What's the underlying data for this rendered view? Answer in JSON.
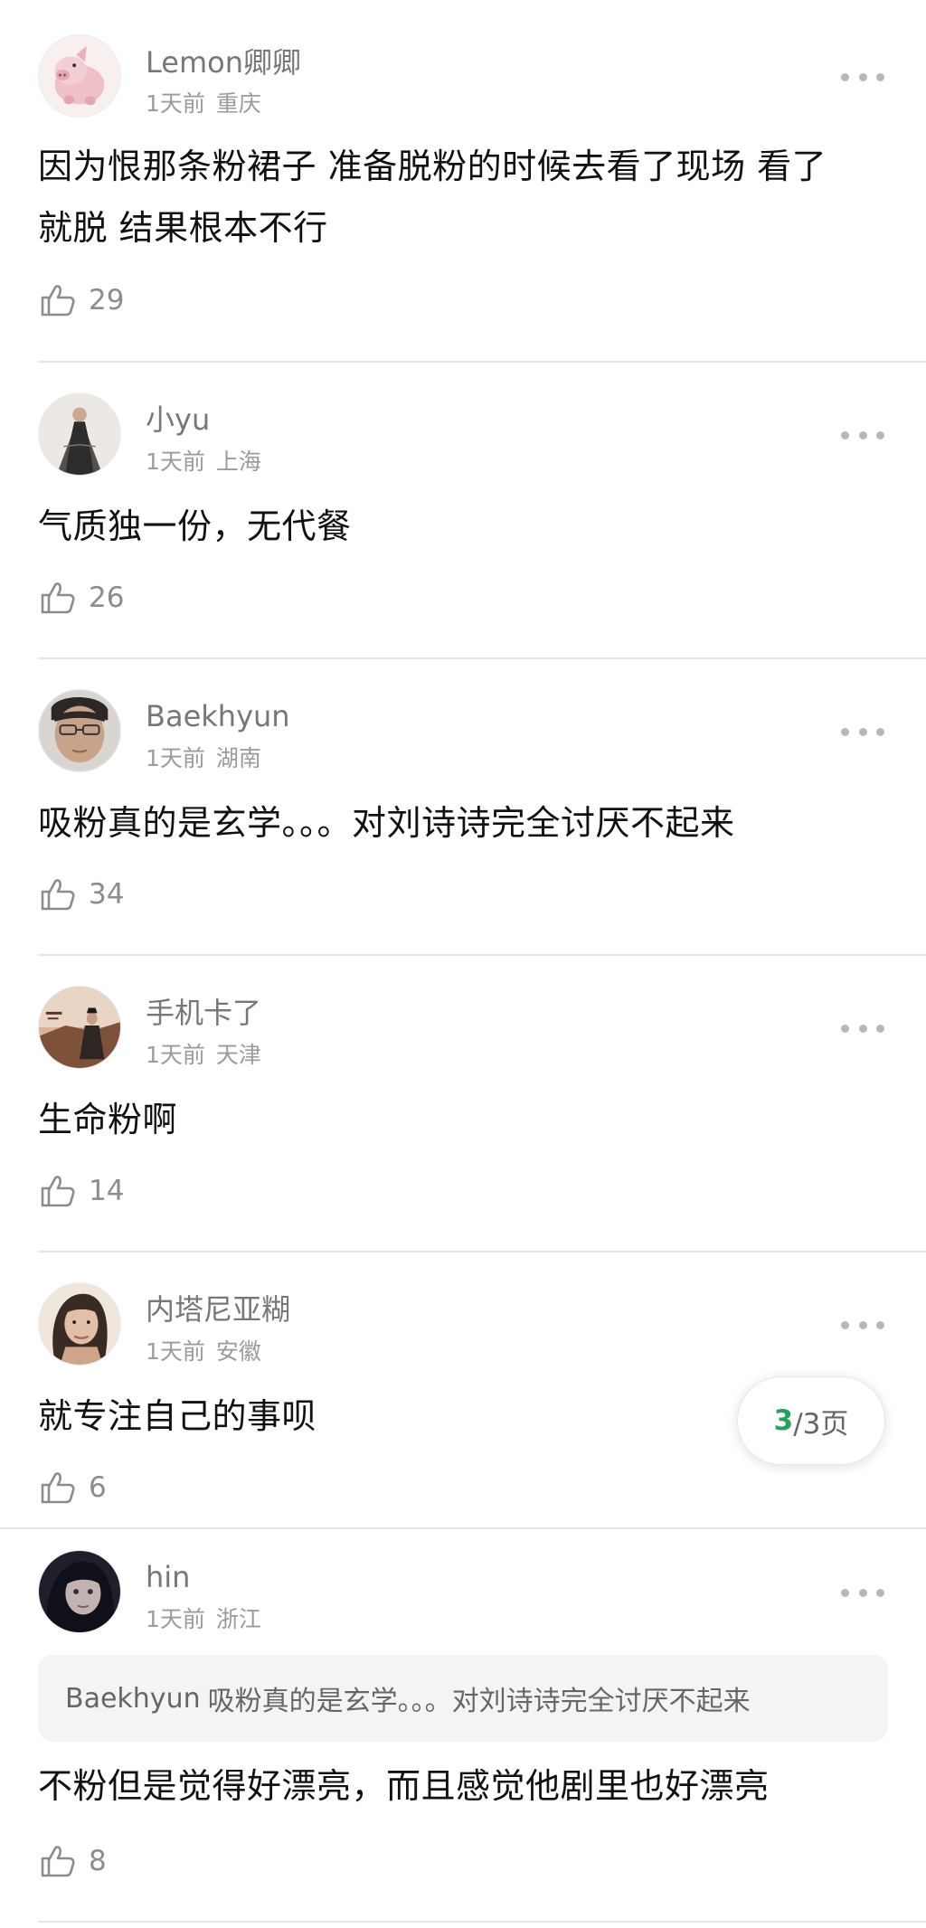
{
  "comments": [
    {
      "username": "Lemon卿卿",
      "time": "1天前",
      "location": "重庆",
      "text_lines": [
        "因为恨那条粉裙子 准备脱粉的时候去看了现场 看了",
        "就脱 结果根本不行"
      ],
      "likes": "29",
      "avatar_icon": "pink-pig-avatar"
    },
    {
      "username": "小yu",
      "time": "1天前",
      "location": "上海",
      "text_lines": [
        "气质独一份，无代餐"
      ],
      "likes": "26",
      "avatar_icon": "gown-portrait-avatar"
    },
    {
      "username": "Baekhyun",
      "time": "1天前",
      "location": "湖南",
      "text_lines": [
        "吸粉真的是玄学。。。对刘诗诗完全讨厌不起来"
      ],
      "likes": "34",
      "avatar_icon": "man-portrait-avatar"
    },
    {
      "username": "手机卡了",
      "time": "1天前",
      "location": "天津",
      "text_lines": [
        "生命粉啊"
      ],
      "likes": "14",
      "avatar_icon": "drama-still-avatar"
    },
    {
      "username": "内塔尼亚糊",
      "time": "1天前",
      "location": "安徽",
      "text_lines": [
        "就专注自己的事呗"
      ],
      "likes": "6",
      "avatar_icon": "woman-portrait-avatar"
    },
    {
      "username": "hin",
      "time": "1天前",
      "location": "浙江",
      "quote": {
        "author": "Baekhyun",
        "text": "吸粉真的是玄学。。。对刘诗诗完全讨厌不起来"
      },
      "text_lines": [
        "不粉但是觉得好漂亮，而且感觉他剧里也好漂亮"
      ],
      "likes": "8",
      "avatar_icon": "dark-portrait-avatar"
    }
  ],
  "pager": {
    "current": "3",
    "rest": "/3页"
  },
  "colors": {
    "accent": "#2aa15b",
    "divider": "#e6e6e6",
    "meta": "#9b9b9b"
  }
}
